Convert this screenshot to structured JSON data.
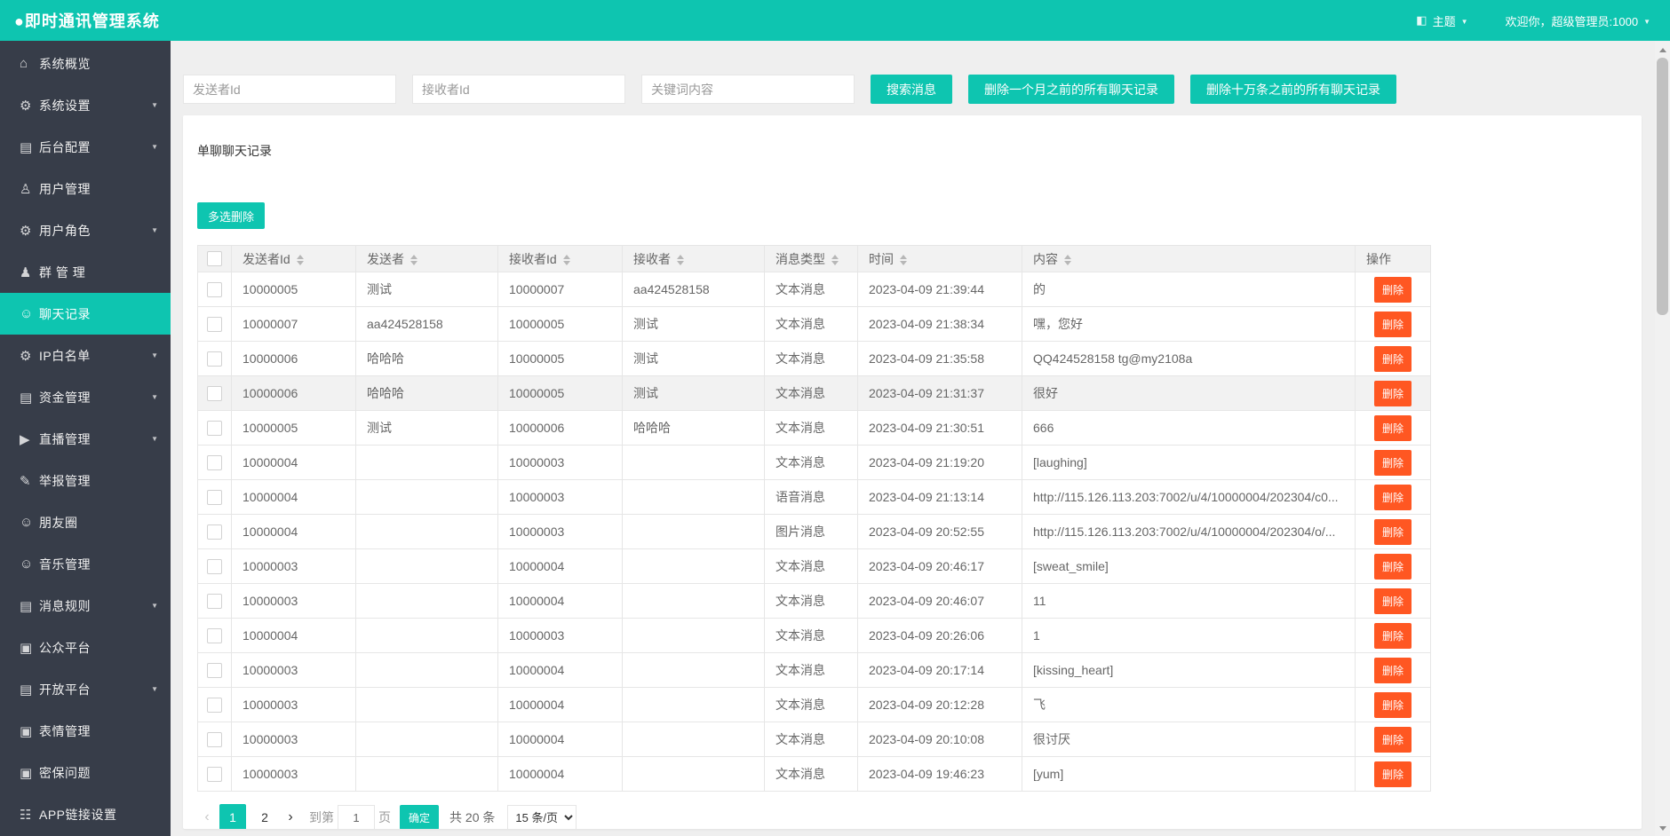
{
  "colors": {
    "accent": "#0EC5B0",
    "sidebar_bg": "#373D49",
    "danger": "#FF5722"
  },
  "header": {
    "title": "●即时通讯管理系统",
    "theme_icon": "◧",
    "theme_label": "主题",
    "welcome": "欢迎你，超级管理员:1000",
    "caret": "▼"
  },
  "sidebar": {
    "arrow_icon": "▼",
    "items": [
      {
        "key": "system-overview",
        "icon": "⌂",
        "label": "系统概览",
        "arrow": false
      },
      {
        "key": "system-settings",
        "icon": "⚙",
        "label": "系统设置",
        "arrow": true
      },
      {
        "key": "backend-config",
        "icon": "▤",
        "label": "后台配置",
        "arrow": true
      },
      {
        "key": "user-management",
        "icon": "♙",
        "label": "用户管理",
        "arrow": false
      },
      {
        "key": "user-roles",
        "icon": "⚙",
        "label": "用户角色",
        "arrow": true
      },
      {
        "key": "group-management",
        "icon": "♟",
        "label": "群 管 理",
        "arrow": false
      },
      {
        "key": "chat-records",
        "icon": "☺",
        "label": "聊天记录",
        "arrow": false,
        "active": true
      },
      {
        "key": "ip-whitelist",
        "icon": "⚙",
        "label": "IP白名单",
        "arrow": true
      },
      {
        "key": "funds-management",
        "icon": "▤",
        "label": "资金管理",
        "arrow": true
      },
      {
        "key": "live-management",
        "icon": "▶",
        "label": "直播管理",
        "arrow": true
      },
      {
        "key": "report-management",
        "icon": "✎",
        "label": "举报管理",
        "arrow": false
      },
      {
        "key": "moments",
        "icon": "☺",
        "label": "朋友圈",
        "arrow": false
      },
      {
        "key": "music-management",
        "icon": "☺",
        "label": "音乐管理",
        "arrow": false
      },
      {
        "key": "message-rules",
        "icon": "▤",
        "label": "消息规则",
        "arrow": true
      },
      {
        "key": "public-platform",
        "icon": "▣",
        "label": "公众平台",
        "arrow": false
      },
      {
        "key": "open-platform",
        "icon": "▤",
        "label": "开放平台",
        "arrow": true
      },
      {
        "key": "emoji-management",
        "icon": "▣",
        "label": "表情管理",
        "arrow": false
      },
      {
        "key": "security-question",
        "icon": "▣",
        "label": "密保问题",
        "arrow": false
      },
      {
        "key": "app-link-settings",
        "icon": "☷",
        "label": "APP链接设置",
        "arrow": false
      }
    ]
  },
  "filters": {
    "sender_placeholder": "发送者Id",
    "receiver_placeholder": "接收者Id",
    "keyword_placeholder": "关键词内容",
    "search_label": "搜索消息",
    "delete_month_label": "删除一个月之前的所有聊天记录",
    "delete_100k_label": "删除十万条之前的所有聊天记录"
  },
  "card": {
    "title": "单聊聊天记录",
    "multi_delete_label": "多选删除",
    "table": {
      "columns": [
        "发送者Id",
        "发送者",
        "接收者Id",
        "接收者",
        "消息类型",
        "时间",
        "内容",
        "操作"
      ],
      "delete_label": "删除",
      "rows": [
        {
          "sender_id": "10000005",
          "sender": "测试",
          "receiver_id": "10000007",
          "receiver": "aa424528158",
          "type": "文本消息",
          "time": "2023-04-09 21:39:44",
          "content": "的"
        },
        {
          "sender_id": "10000007",
          "sender": "aa424528158",
          "receiver_id": "10000005",
          "receiver": "测试",
          "type": "文本消息",
          "time": "2023-04-09 21:38:34",
          "content": "嘿，您好"
        },
        {
          "sender_id": "10000006",
          "sender": "哈哈哈",
          "receiver_id": "10000005",
          "receiver": "测试",
          "type": "文本消息",
          "time": "2023-04-09 21:35:58",
          "content": "QQ424528158 tg@my2108a"
        },
        {
          "sender_id": "10000006",
          "sender": "哈哈哈",
          "receiver_id": "10000005",
          "receiver": "测试",
          "type": "文本消息",
          "time": "2023-04-09 21:31:37",
          "content": "很好",
          "highlighted": true
        },
        {
          "sender_id": "10000005",
          "sender": "测试",
          "receiver_id": "10000006",
          "receiver": "哈哈哈",
          "type": "文本消息",
          "time": "2023-04-09 21:30:51",
          "content": "666"
        },
        {
          "sender_id": "10000004",
          "sender": "",
          "receiver_id": "10000003",
          "receiver": "",
          "type": "文本消息",
          "time": "2023-04-09 21:19:20",
          "content": "[laughing]"
        },
        {
          "sender_id": "10000004",
          "sender": "",
          "receiver_id": "10000003",
          "receiver": "",
          "type": "语音消息",
          "time": "2023-04-09 21:13:14",
          "content": "http://115.126.113.203:7002/u/4/10000004/202304/c0..."
        },
        {
          "sender_id": "10000004",
          "sender": "",
          "receiver_id": "10000003",
          "receiver": "",
          "type": "图片消息",
          "time": "2023-04-09 20:52:55",
          "content": "http://115.126.113.203:7002/u/4/10000004/202304/o/..."
        },
        {
          "sender_id": "10000003",
          "sender": "",
          "receiver_id": "10000004",
          "receiver": "",
          "type": "文本消息",
          "time": "2023-04-09 20:46:17",
          "content": "[sweat_smile]"
        },
        {
          "sender_id": "10000003",
          "sender": "",
          "receiver_id": "10000004",
          "receiver": "",
          "type": "文本消息",
          "time": "2023-04-09 20:46:07",
          "content": "11"
        },
        {
          "sender_id": "10000004",
          "sender": "",
          "receiver_id": "10000003",
          "receiver": "",
          "type": "文本消息",
          "time": "2023-04-09 20:26:06",
          "content": "1"
        },
        {
          "sender_id": "10000003",
          "sender": "",
          "receiver_id": "10000004",
          "receiver": "",
          "type": "文本消息",
          "time": "2023-04-09 20:17:14",
          "content": "[kissing_heart]"
        },
        {
          "sender_id": "10000003",
          "sender": "",
          "receiver_id": "10000004",
          "receiver": "",
          "type": "文本消息",
          "time": "2023-04-09 20:12:28",
          "content": "飞"
        },
        {
          "sender_id": "10000003",
          "sender": "",
          "receiver_id": "10000004",
          "receiver": "",
          "type": "文本消息",
          "time": "2023-04-09 20:10:08",
          "content": "很讨厌"
        },
        {
          "sender_id": "10000003",
          "sender": "",
          "receiver_id": "10000004",
          "receiver": "",
          "type": "文本消息",
          "time": "2023-04-09 19:46:23",
          "content": "[yum]"
        }
      ]
    },
    "pagination": {
      "prev": "‹",
      "pages": [
        "1",
        "2"
      ],
      "active_page": "1",
      "next": "›",
      "goto_label": "到第",
      "goto_value": "1",
      "page_label": "页",
      "confirm_label": "确定",
      "total_label": "共 20 条",
      "per_page": "15 条/页"
    }
  }
}
